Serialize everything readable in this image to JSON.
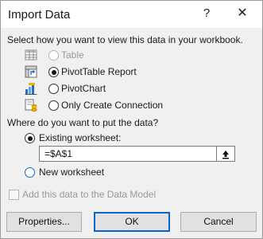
{
  "dialog": {
    "title": "Import Data",
    "help_label": "?",
    "close_label": "✕"
  },
  "view": {
    "prompt": "Select how you want to view this data in your workbook.",
    "options": [
      {
        "label": "Table",
        "icon": "table-icon",
        "state": "disabled"
      },
      {
        "label": "PivotTable Report",
        "icon": "pivottable-icon",
        "state": "selected"
      },
      {
        "label": "PivotChart",
        "icon": "pivotchart-icon",
        "state": "unselected"
      },
      {
        "label": "Only Create Connection",
        "icon": "connection-icon",
        "state": "unselected"
      }
    ]
  },
  "destination": {
    "prompt": "Where do you want to put the data?",
    "existing_label": "Existing worksheet:",
    "existing_selected": true,
    "reference_value": "=$A$1",
    "collapse_icon": "up-arrow-icon",
    "new_label": "New worksheet",
    "new_selected": false
  },
  "data_model": {
    "label": "Add this data to the Data Model",
    "checked": false,
    "enabled": false
  },
  "buttons": {
    "properties": "Properties...",
    "ok": "OK",
    "cancel": "Cancel"
  },
  "colors": {
    "default_button_border": "#0a64c8",
    "radio_focus_blue": "#0f6cbd",
    "disabled_text": "#9a9a9a"
  }
}
